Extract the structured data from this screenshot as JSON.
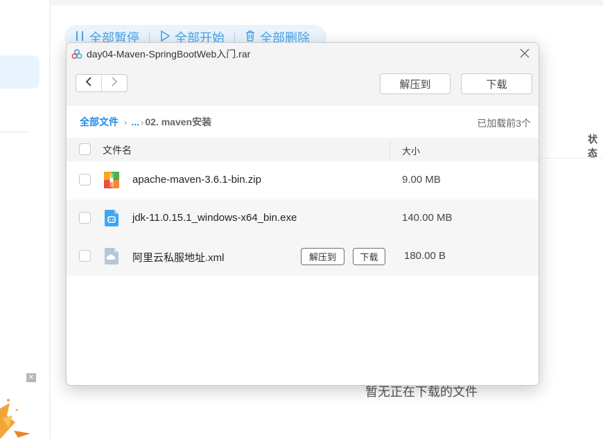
{
  "background": {
    "toolbar": {
      "pause_all": "全部暂停",
      "start_all": "全部开始",
      "delete_all": "全部删除"
    },
    "status_header": "状态",
    "empty_text": "暂无正在下载的文件",
    "ad_close": "✕"
  },
  "modal": {
    "title": "day04-Maven-SpringBootWeb入门.rar",
    "extract_label": "解压到",
    "download_label": "下载",
    "breadcrumb": {
      "root": "全部文件",
      "ellipsis": "...",
      "current": "02. maven安装"
    },
    "loaded_text": "已加载前3个",
    "columns": {
      "name": "文件名",
      "size": "大小"
    },
    "files": [
      {
        "name": "apache-maven-3.6.1-bin.zip",
        "size": "9.00 MB",
        "icon": "zip-archive-icon"
      },
      {
        "name": "jdk-11.0.15.1_windows-x64_bin.exe",
        "size": "140.00 MB",
        "icon": "exe-file-icon"
      },
      {
        "name": "阿里云私服地址.xml",
        "size": "180.00 B",
        "icon": "xml-file-icon",
        "hover_extract": "解压到",
        "hover_download": "下载"
      }
    ]
  },
  "colors": {
    "accent": "#1e8be6",
    "toolbar_bg": "#e9f4fd",
    "toolbar_text": "#4aa3e8"
  }
}
